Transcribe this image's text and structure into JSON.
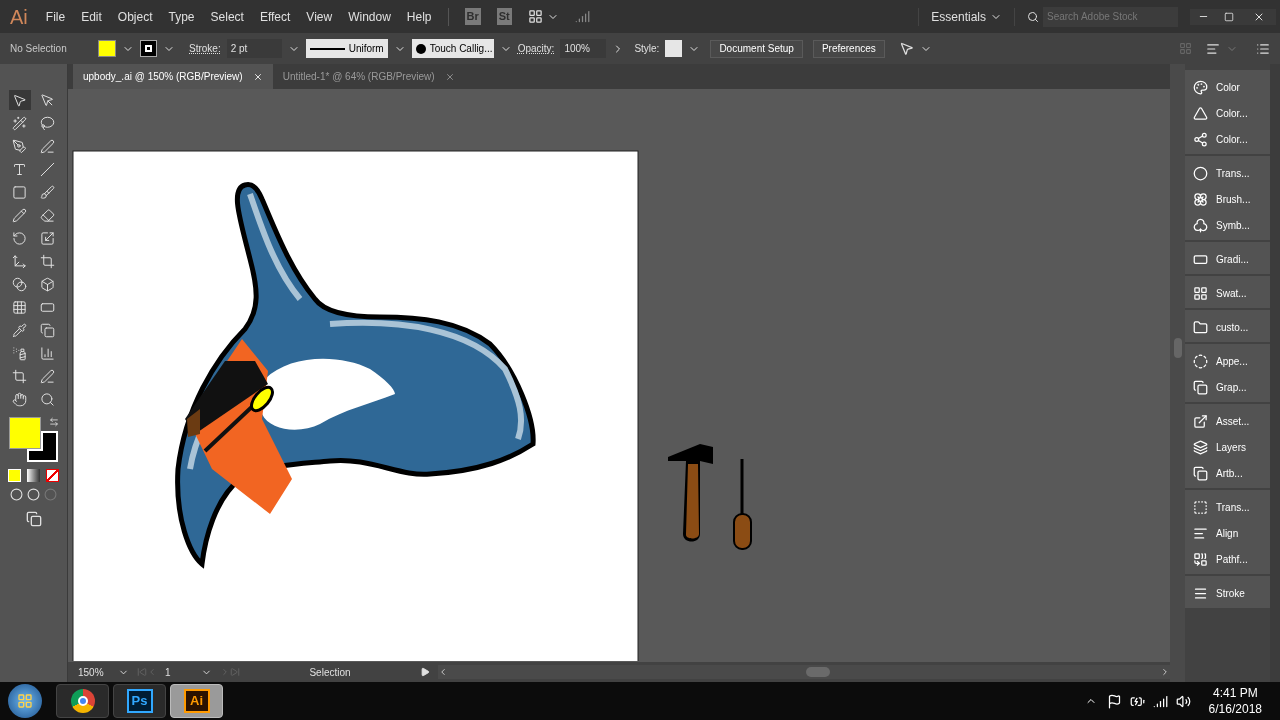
{
  "app": {
    "logo": "Ai",
    "menu": [
      "File",
      "Edit",
      "Object",
      "Type",
      "Select",
      "Effect",
      "View",
      "Window",
      "Help"
    ],
    "bridge_badges": [
      "Br",
      "St"
    ],
    "workspace": "Essentials",
    "search": {
      "placeholder": "Search Adobe Stock"
    }
  },
  "control_bar": {
    "selection": "No Selection",
    "stroke_label": "Stroke:",
    "stroke_weight": "2 pt",
    "profile": "Uniform",
    "brush": "Touch Callig...",
    "opacity_label": "Opacity:",
    "opacity": "100%",
    "style_label": "Style:",
    "buttons": [
      "Document Setup",
      "Preferences"
    ]
  },
  "tabs": [
    {
      "label": "upbody_.ai @ 150% (RGB/Preview)",
      "selected": true
    },
    {
      "label": "Untitled-1* @ 64% (RGB/Preview)",
      "selected": false
    }
  ],
  "panels": [
    {
      "items": [
        "Color",
        "Color...",
        "Color..."
      ]
    },
    {
      "items": [
        "Trans...",
        "Brush...",
        "Symb..."
      ]
    },
    {
      "items": [
        "Gradi..."
      ]
    },
    {
      "items": [
        "Swat..."
      ]
    },
    {
      "items": [
        "custo..."
      ]
    },
    {
      "items": [
        "Appe...",
        "Grap..."
      ]
    },
    {
      "items": [
        "Asset...",
        "Layers",
        "Artb..."
      ]
    },
    {
      "items": [
        "Trans...",
        "Align",
        "Pathf..."
      ]
    },
    {
      "items": [
        "Stroke"
      ]
    }
  ],
  "status_bar": {
    "zoom": "150%",
    "artboard": "1",
    "tool": "Selection"
  },
  "taskbar": {
    "apps": [
      {
        "kind": "browser",
        "selected": false
      },
      {
        "kind": "ps",
        "label": "Ps",
        "selected": false
      },
      {
        "kind": "ai",
        "label": "Ai",
        "selected": true
      }
    ],
    "time": "4:41 PM",
    "date": "6/16/2018"
  }
}
